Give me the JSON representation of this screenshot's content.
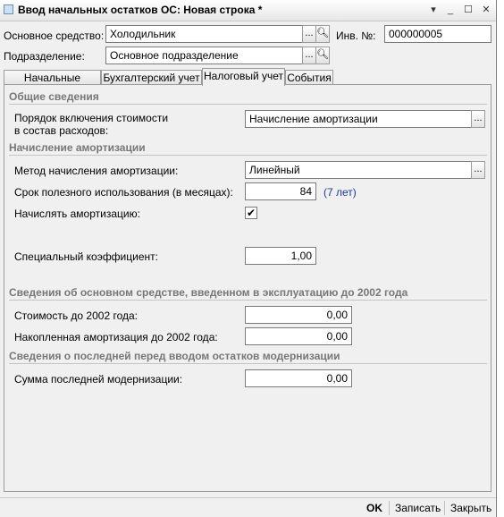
{
  "window": {
    "title": "Ввод начальных остатков ОС: Новая строка *"
  },
  "header": {
    "asset_label": "Основное средство:",
    "asset_value": "Холодильник",
    "inv_label": "Инв. №:",
    "inv_value": "000000005",
    "division_label": "Подразделение:",
    "division_value": "Основное подразделение"
  },
  "tabs": [
    {
      "label": "Начальные остатки"
    },
    {
      "label": "Бухгалтерский учет"
    },
    {
      "label": "Налоговый учет"
    },
    {
      "label": "События"
    }
  ],
  "active_tab": "Налоговый учет",
  "tax": {
    "general_section": "Общие сведения",
    "cost_order_label_1": "Порядок включения стоимости",
    "cost_order_label_2": "в состав расходов:",
    "cost_order_value": "Начисление амортизации",
    "depr_section": "Начисление амортизации",
    "method_label": "Метод начисления амортизации:",
    "method_value": "Линейный",
    "term_label": "Срок полезного использования (в месяцах):",
    "term_value": "84",
    "term_years": "(7 лет)",
    "accrue_label": "Начислять амортизацию:",
    "accrue_checked": true,
    "coef_label": "Специальный коэффициент:",
    "coef_value": "1,00",
    "pre2002_section": "Сведения об основном средстве, введенном в эксплуатацию до 2002 года",
    "cost2002_label": "Стоимость до 2002 года:",
    "cost2002_value": "0,00",
    "accum2002_label": "Накопленная амортизация до 2002 года:",
    "accum2002_value": "0,00",
    "modern_section": "Сведения о последней перед вводом остатков модернизации",
    "modern_label": "Сумма последней модернизации:",
    "modern_value": "0,00"
  },
  "footer": {
    "ok": "OK",
    "save": "Записать",
    "close": "Закрыть"
  }
}
